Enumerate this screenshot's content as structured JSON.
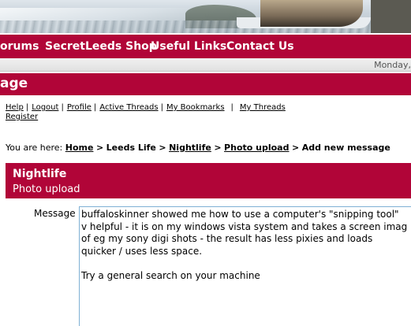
{
  "nav": {
    "items": [
      "orums",
      "SecretLeeds Shop",
      "Useful Links",
      "Contact Us"
    ]
  },
  "date": "Monday,",
  "page_title": "age",
  "user_links": [
    "Help",
    "Logout",
    "Profile",
    "Active Threads",
    "My Bookmarks",
    "My Threads",
    "Register"
  ],
  "breadcrumb": {
    "prefix": "You are here:",
    "home": "Home",
    "leeds_life": "Leeds Life",
    "nightlife": "Nightlife",
    "photo_upload": "Photo upload",
    "current": "Add new message",
    "sep": ">"
  },
  "forum": {
    "title": "Nightlife",
    "subtitle": "Photo upload"
  },
  "message": {
    "label": "Message",
    "lines": [
      "buffaloskinner showed me how to use a computer's \"snipping tool\"",
      "v helpful - it is on my windows vista system and takes a screen imag",
      "of eg my sony digi shots - the result has less pixies and loads",
      "quicker / uses less space.",
      "",
      "Try a general search on your machine"
    ]
  },
  "colors": {
    "brand": "#b10538",
    "textarea_border": "#7fb0d4"
  }
}
